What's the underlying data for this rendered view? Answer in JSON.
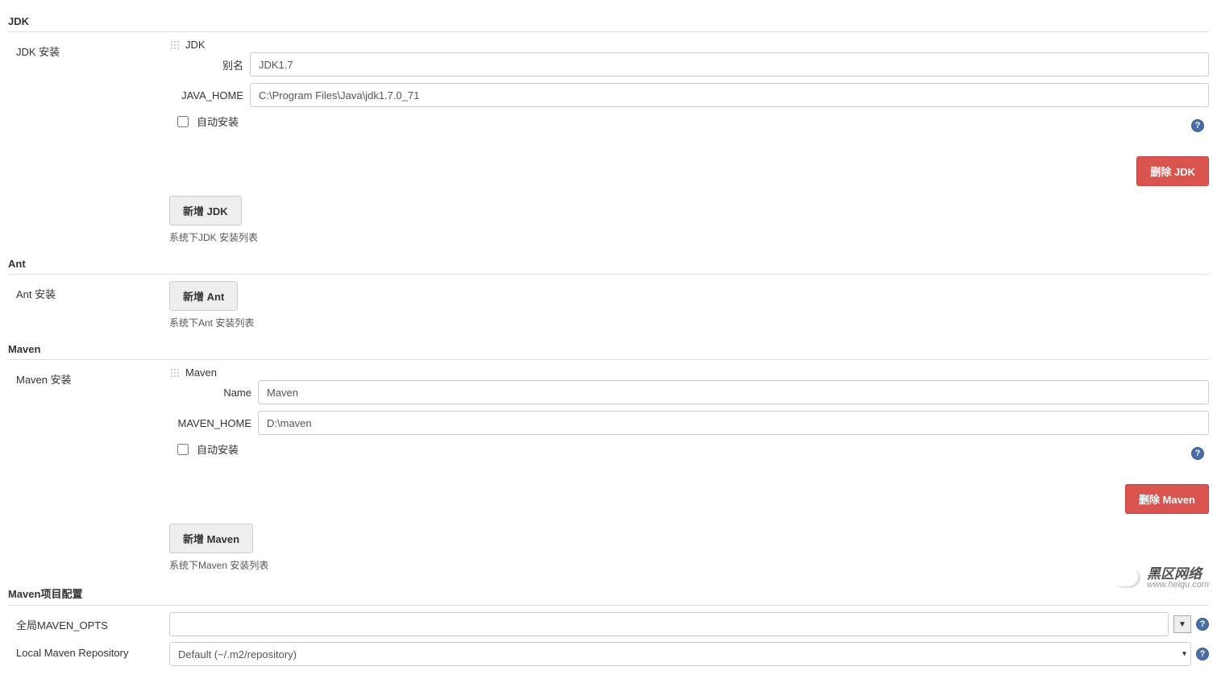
{
  "sections": {
    "jdk": {
      "title": "JDK",
      "install_label": "JDK 安装",
      "tool_title": "JDK",
      "alias_label": "别名",
      "alias_value": "JDK1.7",
      "home_label": "JAVA_HOME",
      "home_value": "C:\\Program Files\\Java\\jdk1.7.0_71",
      "auto_install_label": "自动安装",
      "delete_btn": "删除 JDK",
      "add_btn": "新增 JDK",
      "list_note": "系统下JDK 安装列表"
    },
    "ant": {
      "title": "Ant",
      "install_label": "Ant 安装",
      "add_btn": "新增 Ant",
      "list_note": "系统下Ant 安装列表"
    },
    "maven": {
      "title": "Maven",
      "install_label": "Maven 安装",
      "tool_title": "Maven",
      "name_label": "Name",
      "name_value": "Maven",
      "home_label": "MAVEN_HOME",
      "home_value": "D:\\maven",
      "auto_install_label": "自动安装",
      "delete_btn": "删除 Maven",
      "add_btn": "新增 Maven",
      "list_note": "系统下Maven 安装列表"
    },
    "maven_project": {
      "title": "Maven项目配置",
      "global_opts_label": "全局MAVEN_OPTS",
      "global_opts_value": "",
      "local_repo_label": "Local Maven Repository",
      "local_repo_value": "Default (~/.m2/repository)"
    }
  },
  "watermark": {
    "big": "黑区网络",
    "small": "www.heiqu.com"
  }
}
